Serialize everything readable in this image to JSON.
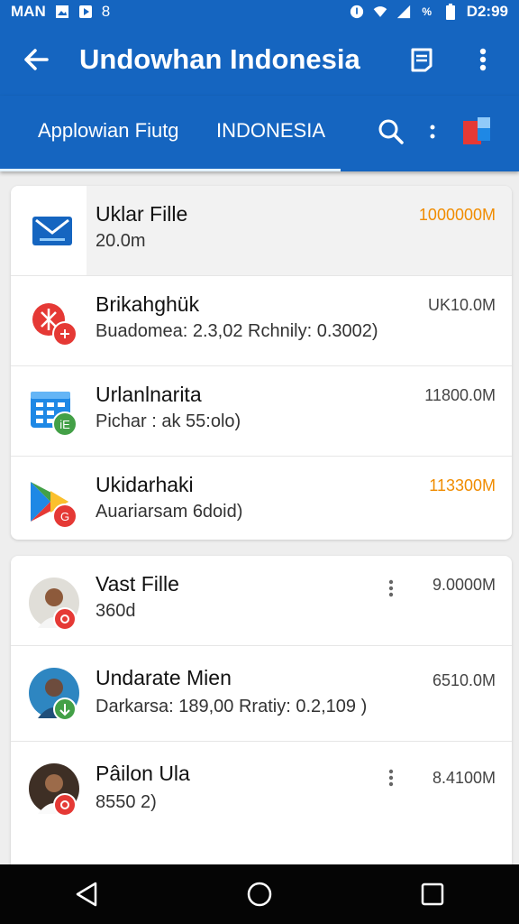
{
  "status_bar": {
    "carrier": "MAN",
    "extra": "8",
    "time": "D2:99"
  },
  "app_bar": {
    "title": "Undowhan Indonesia",
    "back_icon": "arrow-left-icon",
    "actions": [
      "note-icon",
      "more-vert-icon"
    ]
  },
  "tabs": {
    "items": [
      {
        "label": "Applowian Fiutg"
      },
      {
        "label": "INDONESIA"
      }
    ],
    "search_icon": "search-icon",
    "more_icon": "more-vert-icon"
  },
  "colors": {
    "primary": "#1565c0",
    "accent_orange": "#f08c00",
    "badge_red": "#e53935",
    "badge_green": "#43a047"
  },
  "list_top": [
    {
      "title": "Uklar Fille",
      "subtitle": "20.0m",
      "value": "1000000M",
      "value_color": "orange",
      "icon": "envelope-icon"
    },
    {
      "title": "Brikahghük",
      "subtitle": "Buadomea: 2.3,02 Rchnily: 0.3002)",
      "value": "UK10.0M",
      "value_color": "gray",
      "icon": "app-red-icon"
    },
    {
      "title": "Urlanlnarita",
      "subtitle": "Pichar : ak 55:olo)",
      "value": "11800.0M",
      "value_color": "gray",
      "icon": "calculator-icon"
    },
    {
      "title": "Ukidarhaki",
      "subtitle": "Auariarsam 6doid)",
      "value": "113300M",
      "value_color": "orange",
      "icon": "play-store-icon"
    }
  ],
  "list_bottom": [
    {
      "title": "Vast Fille",
      "subtitle": "360d",
      "value": "9.0000M",
      "kebab": true,
      "badge": "red"
    },
    {
      "title": "Undarate Mien",
      "subtitle": "Darkarsa: 189,00 Rratiy: 0.2,109   )",
      "value": "6510.0M",
      "kebab": false,
      "badge": "green"
    },
    {
      "title": "Pâilon Ula",
      "subtitle": "8550 2)",
      "value": "8.4100M",
      "kebab": true,
      "badge": "red"
    }
  ],
  "nav": [
    "back-triangle-icon",
    "home-circle-icon",
    "recents-square-icon"
  ]
}
